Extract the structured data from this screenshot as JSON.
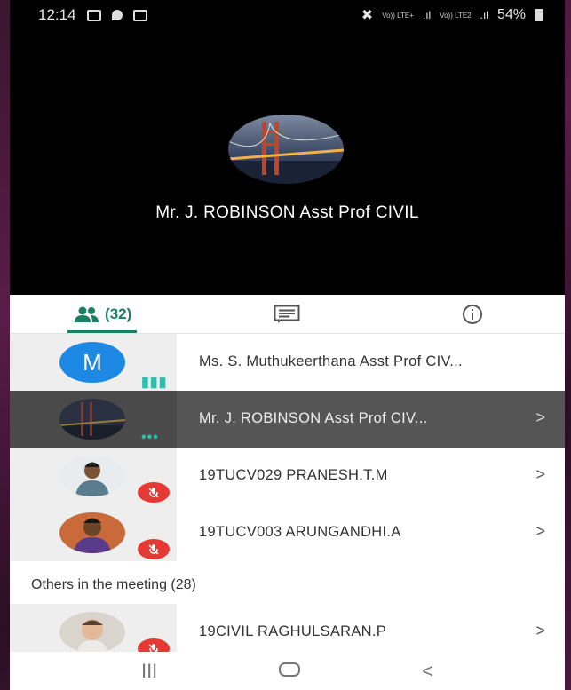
{
  "status_bar": {
    "time": "12:14",
    "signal_text_1": "Vo)) LTE+",
    "signal_text_2": "Vo)) LTE2",
    "battery": "54%"
  },
  "presenter": {
    "name": "Mr. J. ROBINSON Asst Prof CIVIL"
  },
  "tabs": {
    "participants_count": "(32)"
  },
  "participants": [
    {
      "initial": "M",
      "name": "Ms. S. Muthukeerthana Asst Prof CIV..."
    },
    {
      "name": "Mr. J. ROBINSON Asst Prof CIV...",
      "arrow": ">"
    },
    {
      "name": "19TUCV029 PRANESH.T.M",
      "arrow": ">"
    },
    {
      "name": "19TUCV003 ARUNGANDHI.A",
      "arrow": ">"
    }
  ],
  "others": {
    "header": "Others in the meeting (28)",
    "items": [
      {
        "name": "19CIVIL RAGHULSARAN.P",
        "arrow": ">"
      }
    ]
  },
  "navbar": {
    "recents": "III",
    "back": "<"
  },
  "colors": {
    "accent": "#1a7f64",
    "mute": "#e53935",
    "avatar_m": "#1e88e5"
  }
}
